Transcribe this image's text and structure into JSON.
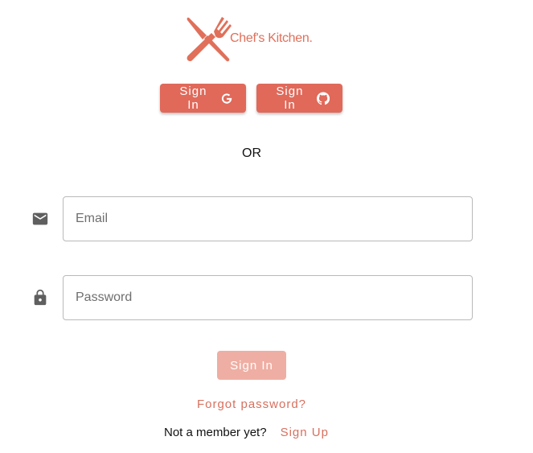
{
  "brand": {
    "name": "Chef's Kitchen.",
    "logo_icon": "knife-fork-icon",
    "color": "#e0705a"
  },
  "oauth": {
    "google_label": "Sign In",
    "google_icon": "google-icon",
    "github_label": "Sign In",
    "github_icon": "github-icon"
  },
  "divider": {
    "text": "OR"
  },
  "form": {
    "email_placeholder": "Email",
    "email_value": "",
    "email_icon": "mail-icon",
    "password_placeholder": "Password",
    "password_value": "",
    "password_icon": "lock-icon",
    "submit_label": "Sign In"
  },
  "links": {
    "forgot_password": "Forgot password?",
    "not_member": "Not a member yet?",
    "sign_up": "Sign Up"
  },
  "colors": {
    "accent": "#e0695a",
    "accent_disabled": "#efaea3",
    "link": "#d7705e"
  }
}
